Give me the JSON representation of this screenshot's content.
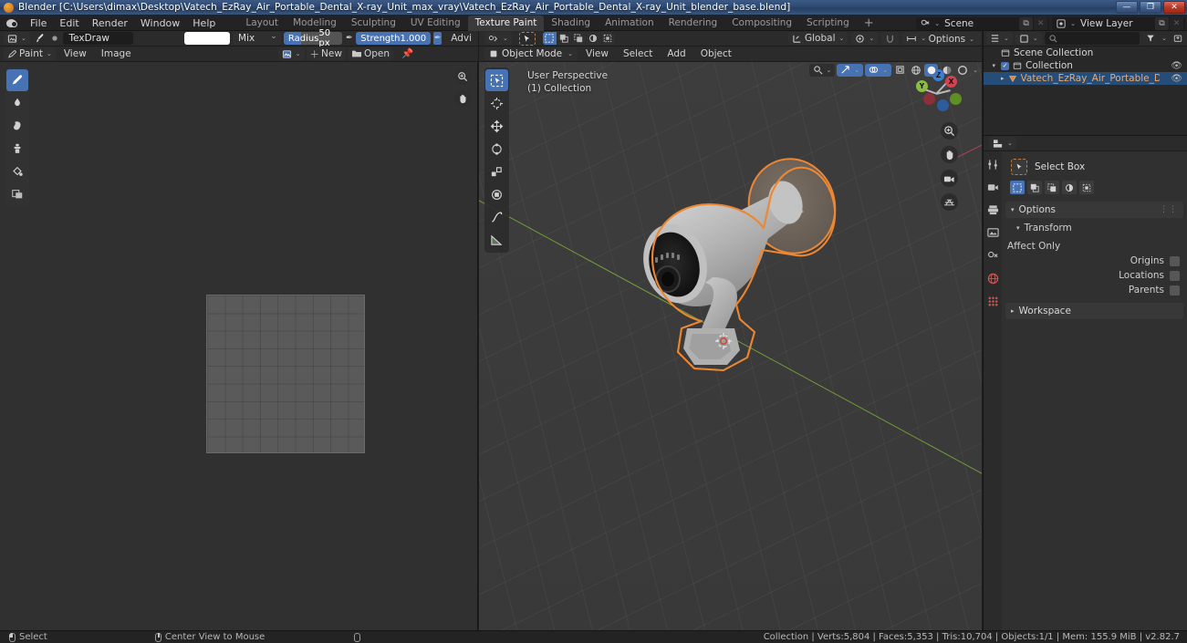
{
  "window": {
    "title": "Blender [C:\\Users\\dimax\\Desktop\\Vatech_EzRay_Air_Portable_Dental_X-ray_Unit_max_vray\\Vatech_EzRay_Air_Portable_Dental_X-ray_Unit_blender_base.blend]",
    "minimize": "—",
    "maximize": "❐",
    "close": "✕"
  },
  "topbar": {
    "menus": [
      "File",
      "Edit",
      "Render",
      "Window",
      "Help"
    ],
    "workspaces": [
      {
        "label": "Layout",
        "active": false
      },
      {
        "label": "Modeling",
        "active": false
      },
      {
        "label": "Sculpting",
        "active": false
      },
      {
        "label": "UV Editing",
        "active": false
      },
      {
        "label": "Texture Paint",
        "active": true
      },
      {
        "label": "Shading",
        "active": false
      },
      {
        "label": "Animation",
        "active": false
      },
      {
        "label": "Rendering",
        "active": false
      },
      {
        "label": "Compositing",
        "active": false
      },
      {
        "label": "Scripting",
        "active": false
      }
    ],
    "add_workspace": "+",
    "scene_label": "Scene",
    "view_layer_label": "View Layer"
  },
  "image_editor": {
    "brush_name": "TexDraw",
    "blend_mode": "Mix",
    "color_hex": "#ffffff",
    "radius_label": "Radius",
    "radius_value": "50 px",
    "strength_label": "Strength",
    "strength_value": "1.000",
    "advanced_label": "Advi",
    "mode_label": "Paint",
    "menus": [
      "View",
      "Image"
    ],
    "new_button": "New",
    "open_button": "Open",
    "tools": [
      {
        "name": "draw-tool",
        "active": true
      },
      {
        "name": "soften-tool",
        "active": false
      },
      {
        "name": "smear-tool",
        "active": false
      },
      {
        "name": "clone-tool",
        "active": false
      },
      {
        "name": "fill-tool",
        "active": false
      },
      {
        "name": "mask-tool",
        "active": false
      }
    ]
  },
  "viewport": {
    "transform_orientation": "Global",
    "options_label": "Options",
    "mode": "Object Mode",
    "menus": [
      "View",
      "Select",
      "Add",
      "Object"
    ],
    "overlay_perspective": "User Perspective",
    "overlay_collection": "(1) Collection",
    "gizmo_axes": [
      {
        "label": "X",
        "color": "#cc4b55"
      },
      {
        "label": "Y",
        "color": "#8dbd40"
      },
      {
        "label": "Z",
        "color": "#3b7fd4"
      }
    ],
    "tools": [
      {
        "name": "select-box-tool",
        "active": true
      },
      {
        "name": "cursor-tool",
        "active": false
      },
      {
        "name": "move-tool",
        "active": false
      },
      {
        "name": "rotate-tool",
        "active": false
      },
      {
        "name": "scale-tool",
        "active": false
      },
      {
        "name": "transform-tool",
        "active": false
      },
      {
        "name": "annotate-tool",
        "active": false
      },
      {
        "name": "measure-tool",
        "active": false
      }
    ]
  },
  "outliner": {
    "scene_collection": "Scene Collection",
    "collection": "Collection",
    "object": "Vatech_EzRay_Air_Portable_Dental_X-ray_U",
    "search_placeholder": ""
  },
  "properties": {
    "tool_name": "Select Box",
    "options_panel": "Options",
    "transform_panel": "Transform",
    "affect_only_label": "Affect Only",
    "affect_rows": [
      {
        "label": "Origins",
        "checked": false
      },
      {
        "label": "Locations",
        "checked": false
      },
      {
        "label": "Parents",
        "checked": false
      }
    ],
    "workspace_panel": "Workspace"
  },
  "statusbar": {
    "left_items": [
      {
        "icon": "lmb",
        "label": "Select"
      },
      {
        "icon": "mmb",
        "label": "Center View to Mouse"
      },
      {
        "icon": "rmb",
        "label": ""
      }
    ],
    "stats": "Collection | Verts:5,804 | Faces:5,353 | Tris:10,704 | Objects:1/1 | Mem: 155.9 MiB | v2.82.7"
  },
  "colors": {
    "accent_blue": "#4772b3",
    "select_orange": "#ed8732",
    "bg_dark": "#232323",
    "viewport_bg": "#3b3b3b"
  }
}
